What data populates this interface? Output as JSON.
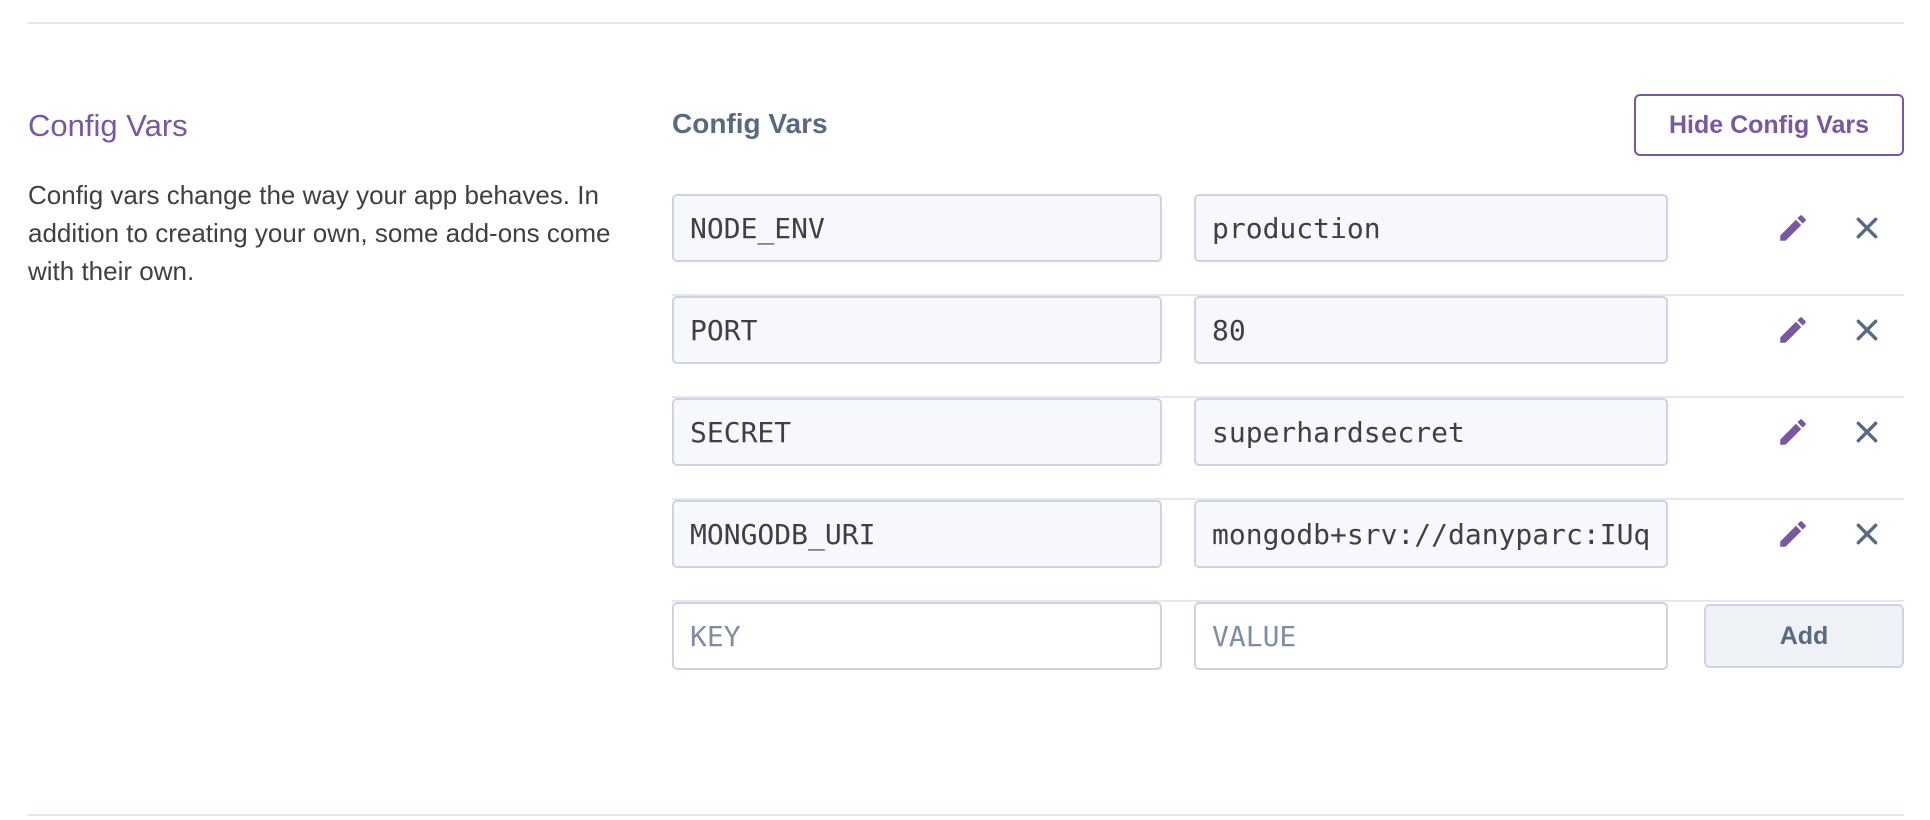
{
  "section": {
    "title": "Config Vars",
    "description": "Config vars change the way your app behaves. In addition to creating your own, some add-ons come with their own."
  },
  "panel": {
    "title": "Config Vars",
    "hide_button_label": "Hide Config Vars"
  },
  "config_vars": [
    {
      "key": "NODE_ENV",
      "value": "production"
    },
    {
      "key": "PORT",
      "value": "80"
    },
    {
      "key": "SECRET",
      "value": "superhardsecret"
    },
    {
      "key": "MONGODB_URI",
      "value": "mongodb+srv://danyparc:IUqU"
    }
  ],
  "new_var": {
    "key_placeholder": "KEY",
    "value_placeholder": "VALUE",
    "add_label": "Add"
  },
  "icons": {
    "edit": "pencil-icon",
    "delete": "close-icon"
  },
  "colors": {
    "accent": "#79589f",
    "muted": "#596981",
    "border": "#ccd3e3"
  }
}
